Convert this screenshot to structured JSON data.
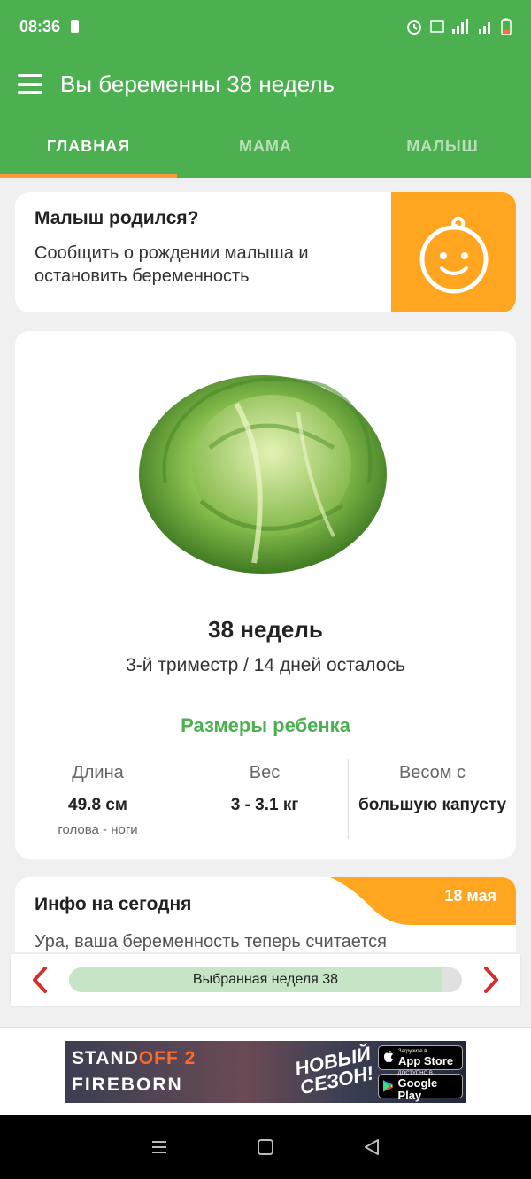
{
  "status_bar": {
    "time": "08:36"
  },
  "app_bar": {
    "title": "Вы беременны 38 недель"
  },
  "tabs": [
    {
      "label": "ГЛАВНАЯ",
      "active": true
    },
    {
      "label": "МАМА",
      "active": false
    },
    {
      "label": "МАЛЫШ",
      "active": false
    }
  ],
  "born_card": {
    "title": "Малыш родился?",
    "description": "Сообщить о рождении малыша и остановить беременность",
    "icon": "baby-face-icon"
  },
  "week_card": {
    "image": "cabbage-image",
    "title": "38 недель",
    "subtitle": "3-й триместр / 14 дней осталось",
    "sizes_title": "Размеры ребенка",
    "sizes": [
      {
        "label": "Длина",
        "value": "49.8 см",
        "note": "голова - ноги"
      },
      {
        "label": "Вес",
        "value": "3 - 3.1 кг",
        "note": ""
      },
      {
        "label": "Весом с",
        "value": "большую капусту",
        "note": ""
      }
    ]
  },
  "info_card": {
    "title": "Инфо на сегодня",
    "date": "18 мая",
    "text": "Ура, ваша беременность теперь считается"
  },
  "week_nav": {
    "label": "Выбранная неделя 38",
    "progress": 0.95
  },
  "ad": {
    "logo_line1_a": "STAND",
    "logo_line1_b": "OFF 2",
    "logo_line2": "FIREBORN",
    "season_line1": "НОВЫЙ",
    "season_line2": "СЕЗОН!",
    "appstore_small": "Загрузите в",
    "appstore_big": "App Store",
    "googleplay_small": "ДОСТУПНО В",
    "googleplay_big": "Google Play"
  },
  "colors": {
    "primary": "#4caf50",
    "accent": "#ffa51f",
    "tab_indicator": "#ff9a3a",
    "nav_arrow": "#d32f2f"
  }
}
